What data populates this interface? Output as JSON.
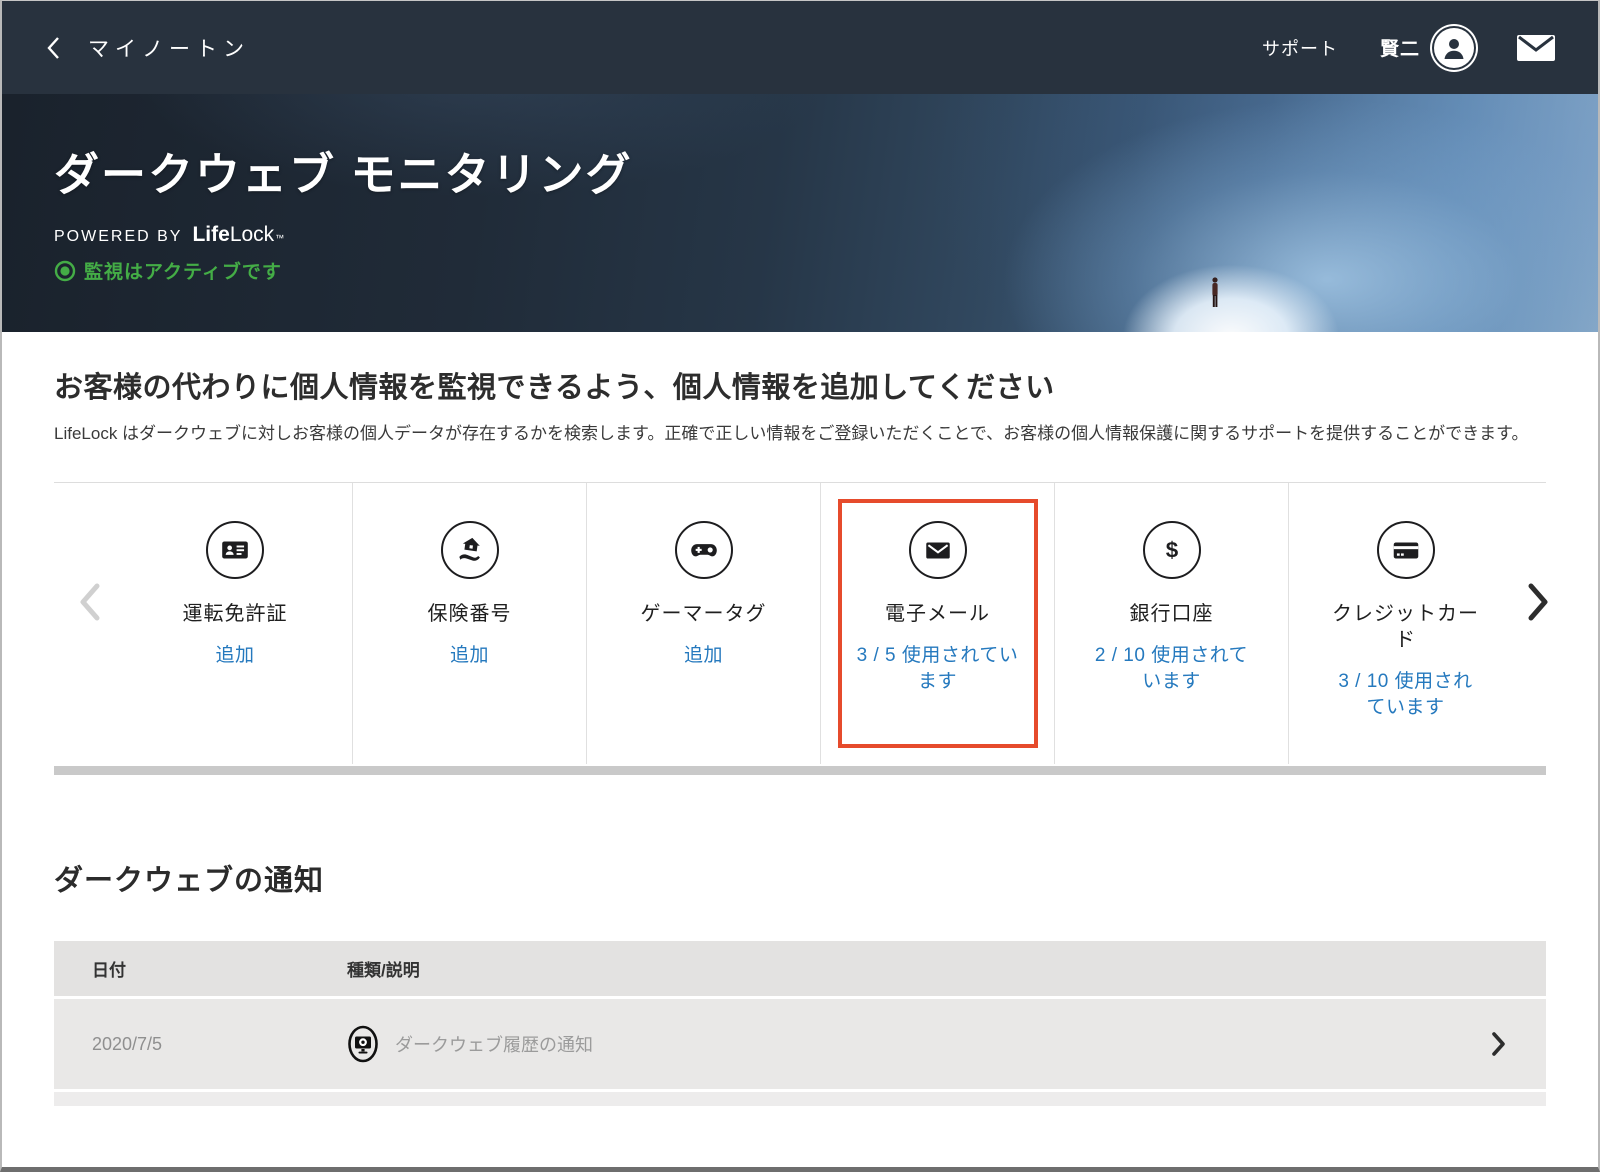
{
  "topbar": {
    "back_label": "マイノートン",
    "support_label": "サポート",
    "username": "賢二"
  },
  "hero": {
    "title": "ダークウェブ モニタリング",
    "powered_by": "POWERED BY",
    "brand_life": "Life",
    "brand_lock": "Lock",
    "trademark": "™",
    "status": "監視はアクティブです"
  },
  "intro": {
    "heading": "お客様の代わりに個人情報を監視できるよう、個人情報を追加してください",
    "body": "LifeLock はダークウェブに対しお客様の個人データが存在するかを検索します。正確で正しい情報をご登録いただくことで、お客様の個人情報保護に関するサポートを提供することができます。"
  },
  "carousel": {
    "items": [
      {
        "label": "運転免許証",
        "action": "追加",
        "icon": "drivers-license"
      },
      {
        "label": "保険番号",
        "action": "追加",
        "icon": "insurance-number"
      },
      {
        "label": "ゲーマータグ",
        "action": "追加",
        "icon": "gamer-tag"
      },
      {
        "label": "電子メール",
        "action": "3 / 5 使用されています",
        "icon": "email",
        "highlighted": "true"
      },
      {
        "label": "銀行口座",
        "action": "2 / 10 使用されています",
        "icon": "bank-account"
      },
      {
        "label": "クレジットカード",
        "action": "3 / 10 使用されています",
        "icon": "credit-card"
      }
    ]
  },
  "notifications": {
    "title": "ダークウェブの通知",
    "columns": {
      "date": "日付",
      "type": "種類/説明"
    },
    "rows": [
      {
        "date": "2020/7/5",
        "description": "ダークウェブ履歴の通知"
      }
    ]
  },
  "colors": {
    "link_blue": "#2579be",
    "highlight_red": "#e64b2c",
    "status_green": "#44ad46",
    "topbar_bg": "#28323e"
  }
}
